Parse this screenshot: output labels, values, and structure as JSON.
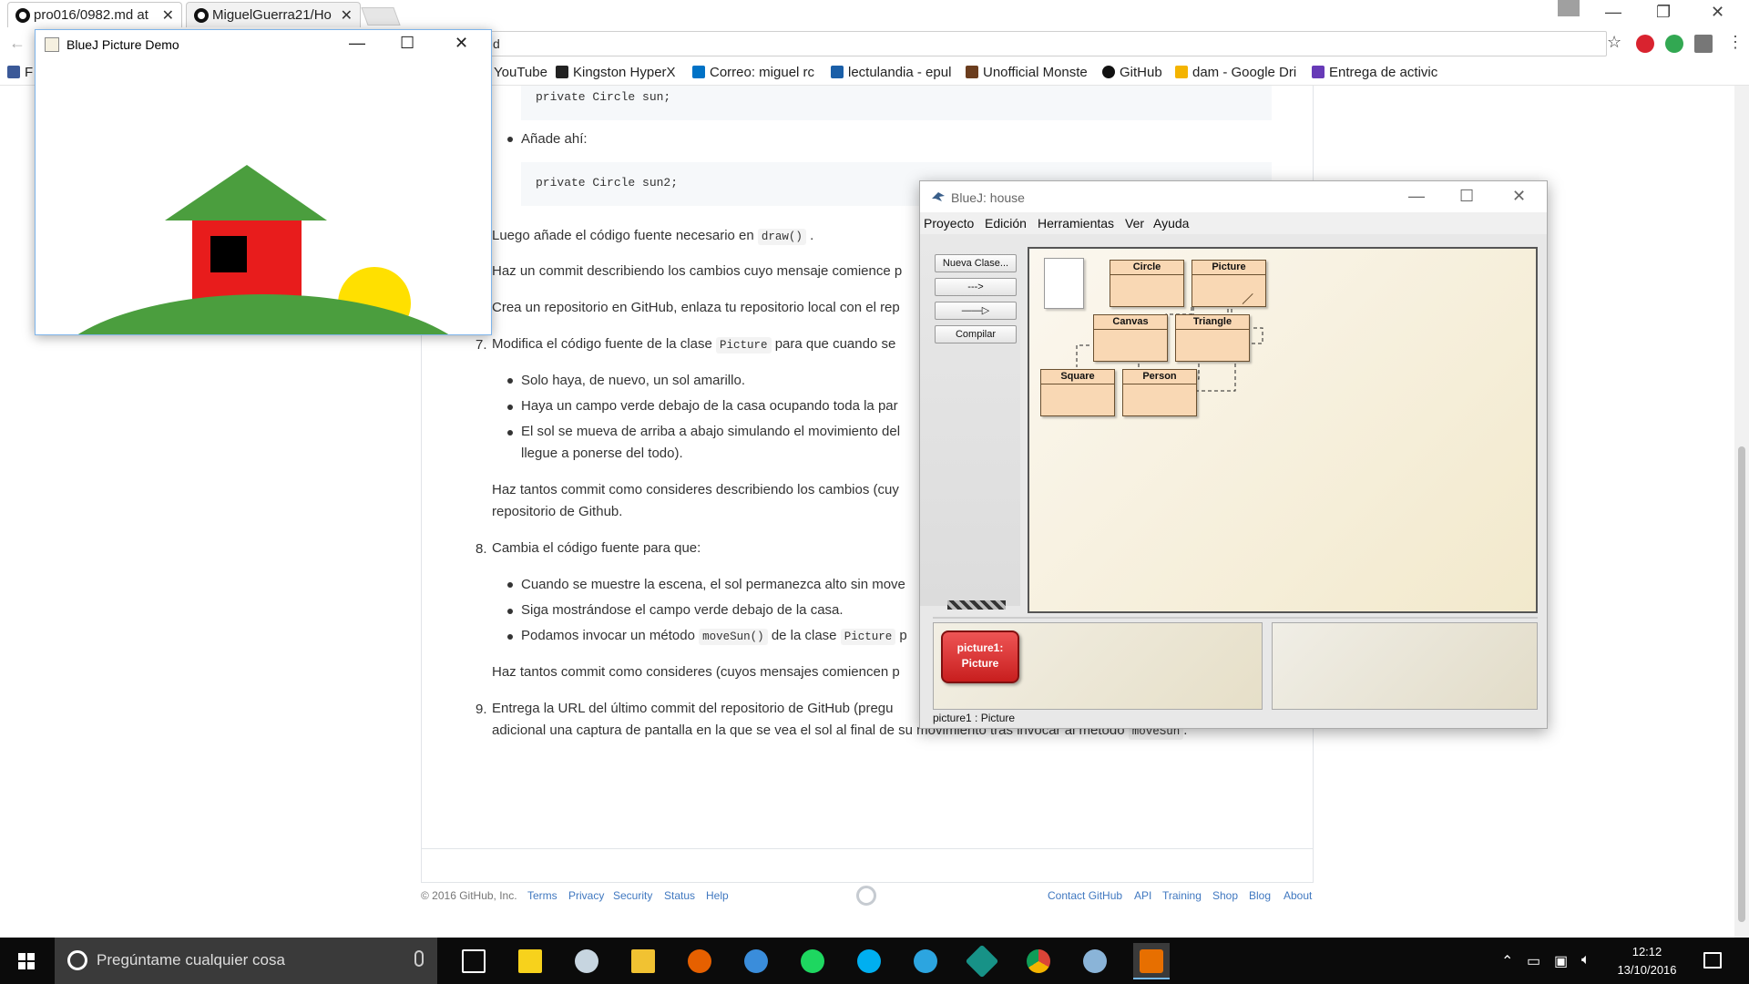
{
  "browser": {
    "tabs": [
      {
        "label": "pro016/0982.md at"
      },
      {
        "label": "MiguelGuerra21/Ho"
      }
    ],
    "url": "d",
    "bookmarks": [
      {
        "label": "F",
        "icon": "facebook-icon",
        "color": "#3b5998"
      },
      {
        "label": "YouTube",
        "icon": "youtube-icon",
        "color": "#e62117"
      },
      {
        "label": "Kingston HyperX",
        "icon": "kingston-icon",
        "color": "#222222"
      },
      {
        "label": "Correo: miguel rc",
        "icon": "outlook-icon",
        "color": "#0072c6"
      },
      {
        "label": "lectulandia - epul",
        "icon": "lectulandia-icon",
        "color": "#1a5fa8"
      },
      {
        "label": "Unofficial Monste",
        "icon": "monster-icon",
        "color": "#6b3d1e"
      },
      {
        "label": "GitHub",
        "icon": "github-icon",
        "color": "#111111"
      },
      {
        "label": "dam - Google Dri",
        "icon": "drive-icon",
        "color": "#f4b400"
      },
      {
        "label": "Entrega de activic",
        "icon": "forms-icon",
        "color": "#673ab7"
      }
    ]
  },
  "article": {
    "code1": "private Circle sun;",
    "step_anade": "Añade ahí:",
    "code2": "private Circle sun2;",
    "p_luego_pre": "Luego añade el código fuente necesario en",
    "p_luego_code": "draw()",
    "p_luego_post": ".",
    "p_commit": "Haz un commit describiendo los cambios cuyo mensaje comience p",
    "p_crea": "Crea un repositorio en GitHub, enlaza tu repositorio local con el rep",
    "item7_num": "7.",
    "item7_pre": "Modifica el código fuente de la clase",
    "item7_code": "Picture",
    "item7_post": "para que cuando se",
    "b7_1": "Solo haya, de nuevo, un sol amarillo.",
    "b7_2": "Haya un campo verde debajo de la casa ocupando toda la par",
    "b7_3": "El sol se mueva de arriba a abajo simulando el movimiento del",
    "b7_3b": "llegue a ponerse del todo).",
    "p7_commit": "Haz tantos commit como consideres describiendo los cambios (cuy",
    "p7_commit_b": "repositorio de Github.",
    "item8_num": "8.",
    "item8": "Cambia el código fuente para que:",
    "b8_1": "Cuando se muestre la escena, el sol permanezca alto sin move",
    "b8_2": "Siga mostrándose el campo verde debajo de la casa.",
    "b8_3_pre": "Podamos invocar un método",
    "b8_3_code": "moveSun()",
    "b8_3_mid": "de la clase",
    "b8_3_code2": "Picture",
    "b8_3_post": "p",
    "p8_commit": "Haz tantos commit como consideres (cuyos mensajes comiencen p",
    "item9_num": "9.",
    "item9_a": "Entrega la URL del último commit del repositorio de GitHub (pregu",
    "item9_b_pre": "adicional una captura de pantalla en la que se vea el sol al final de su movimiento tras invocar al método",
    "item9_b_code": "moveSun",
    "item9_b_post": "."
  },
  "footer": {
    "copyright": "© 2016 GitHub, Inc.",
    "left_links": [
      "Terms",
      "Privacy",
      "Security",
      "Status",
      "Help"
    ],
    "right_links": [
      "Contact GitHub",
      "API",
      "Training",
      "Shop",
      "Blog",
      "About"
    ]
  },
  "picture_demo": {
    "title": "BlueJ Picture Demo",
    "colors": {
      "roof": "#4b9e3e",
      "wall": "#e81c1c",
      "window": "#000000",
      "sun": "#ffe000",
      "ground": "#4b9e3e"
    }
  },
  "bluej": {
    "title": "BlueJ:  house",
    "menu": [
      "Proyecto",
      "Edición",
      "Herramientas",
      "Ver",
      "Ayuda"
    ],
    "buttons": {
      "new_class": "Nueva Clase...",
      "uses_arrow": "--->",
      "inherits_arrow": "——▷",
      "compile": "Compilar"
    },
    "classes": [
      "Circle",
      "Picture",
      "Canvas",
      "Triangle",
      "Square",
      "Person"
    ],
    "object": {
      "line1": "picture1:",
      "line2": "Picture"
    },
    "status": "picture1 : Picture",
    "colors": {
      "class_fill": "#f9d8b4",
      "object_fill": "#d62828"
    }
  },
  "taskbar": {
    "search_placeholder": "Pregúntame cualquier cosa",
    "apps": [
      {
        "name": "task-view-icon",
        "color": "#ffffff"
      },
      {
        "name": "sticky-notes-icon",
        "color": "#f7d21c"
      },
      {
        "name": "steam-icon",
        "color": "#1b2838"
      },
      {
        "name": "file-explorer-icon",
        "color": "#f1c232"
      },
      {
        "name": "firefox-icon",
        "color": "#e66000"
      },
      {
        "name": "thunderbird-icon",
        "color": "#3a8ddb"
      },
      {
        "name": "spotify-icon",
        "color": "#1ed760"
      },
      {
        "name": "skype-icon",
        "color": "#00aff0"
      },
      {
        "name": "telegram-icon",
        "color": "#2ca5e0"
      },
      {
        "name": "gitkraken-icon",
        "color": "#179287"
      },
      {
        "name": "chrome-icon",
        "color": "#db4437"
      },
      {
        "name": "bluej-icon",
        "color": "#8ab4d8"
      },
      {
        "name": "java-icon",
        "color": "#e76f00"
      }
    ],
    "time": "12:12",
    "date": "13/10/2016"
  }
}
